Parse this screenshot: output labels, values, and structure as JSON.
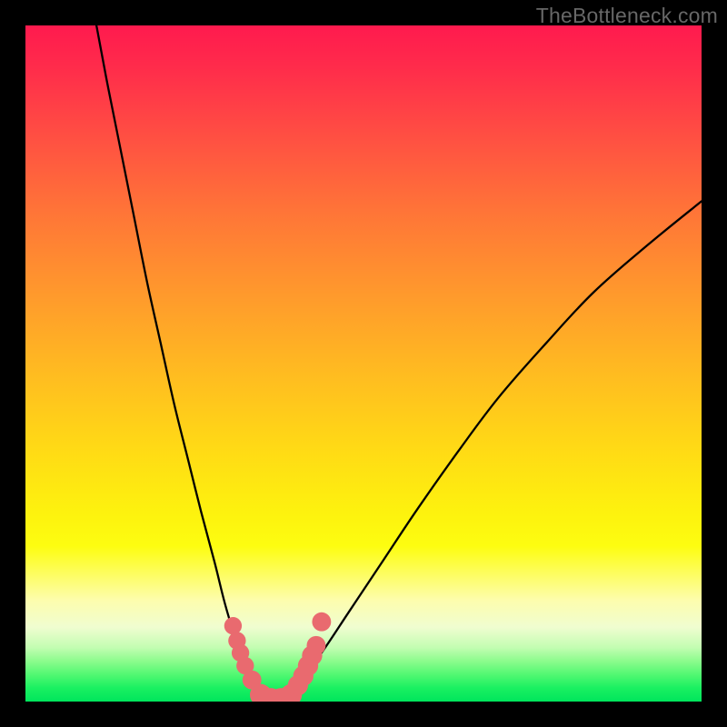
{
  "watermark": "TheBottleneck.com",
  "colors": {
    "background": "#000000",
    "curve": "#000000",
    "dots": "#e96a6f"
  },
  "chart_data": {
    "type": "line",
    "title": "",
    "xlabel": "",
    "ylabel": "",
    "xlim": [
      0,
      100
    ],
    "ylim": [
      0,
      100
    ],
    "series": [
      {
        "name": "left-curve",
        "x": [
          10.5,
          12,
          14,
          16,
          18,
          20,
          22,
          24,
          26,
          28,
          29.5,
          31,
          32.3,
          33.5,
          34.5,
          35.5,
          36.3
        ],
        "y": [
          100,
          92,
          82,
          72,
          62,
          53,
          44,
          36,
          28,
          20.5,
          14.5,
          9.5,
          5.8,
          3.3,
          1.6,
          0.5,
          0.05
        ]
      },
      {
        "name": "right-curve",
        "x": [
          36.3,
          37.5,
          39,
          41,
          44,
          48,
          53,
          58,
          64,
          70,
          77,
          84,
          92,
          100
        ],
        "y": [
          0.05,
          0.5,
          1.6,
          3.6,
          7.5,
          13.5,
          21,
          28.5,
          37,
          45,
          53,
          60.5,
          67.5,
          74
        ]
      }
    ],
    "dots": {
      "name": "highlight-points",
      "points": [
        {
          "x": 30.7,
          "y": 11.2,
          "r": 1.3
        },
        {
          "x": 31.3,
          "y": 9.0,
          "r": 1.3
        },
        {
          "x": 31.8,
          "y": 7.2,
          "r": 1.3
        },
        {
          "x": 32.5,
          "y": 5.3,
          "r": 1.3
        },
        {
          "x": 33.5,
          "y": 3.2,
          "r": 1.4
        },
        {
          "x": 34.8,
          "y": 1.0,
          "r": 1.6
        },
        {
          "x": 36.3,
          "y": 0.4,
          "r": 1.6
        },
        {
          "x": 37.8,
          "y": 0.4,
          "r": 1.6
        },
        {
          "x": 39.3,
          "y": 1.0,
          "r": 1.6
        },
        {
          "x": 40.3,
          "y": 2.4,
          "r": 1.5
        },
        {
          "x": 41.1,
          "y": 3.8,
          "r": 1.5
        },
        {
          "x": 41.8,
          "y": 5.3,
          "r": 1.5
        },
        {
          "x": 42.4,
          "y": 6.8,
          "r": 1.5
        },
        {
          "x": 43.0,
          "y": 8.3,
          "r": 1.4
        },
        {
          "x": 43.8,
          "y": 11.8,
          "r": 1.4
        }
      ]
    }
  }
}
